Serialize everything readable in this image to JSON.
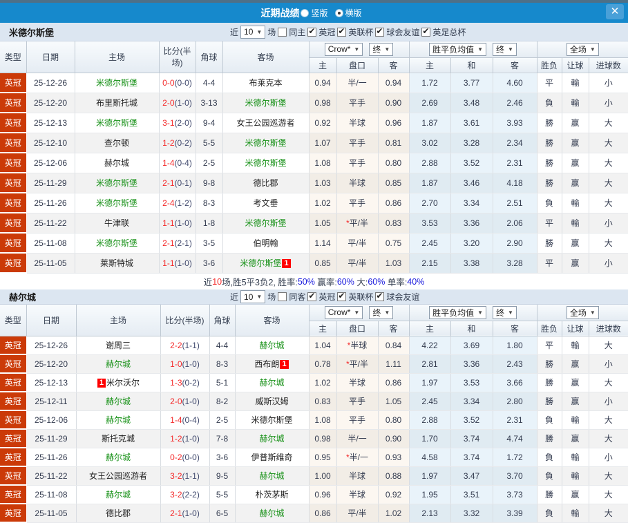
{
  "titlebar": {
    "title": "近期战绩",
    "radio_vertical_label": "竖版",
    "radio_vertical_checked": false,
    "radio_horizontal_label": "横版",
    "radio_horizontal_checked": true,
    "close_label": "✕"
  },
  "colors": {
    "titlebar_blue": "#1689cc",
    "league_badge_red": "#cb3a08",
    "team_green": "#159015",
    "score_red": "#f42a2a",
    "halftime_navy": "#414a6e",
    "win_red": "#d40000",
    "lose_green": "#078007",
    "draw_blue": "#1322cc",
    "band_bg": "#dce6f1"
  },
  "sections": [
    {
      "team": "米德尔斯堡",
      "filters": {
        "near_label": "近",
        "count": "10",
        "games_label": "场",
        "same_label": "同主",
        "same_checked": false,
        "leagues": [
          {
            "label": "英冠",
            "checked": true
          },
          {
            "label": "英联杯",
            "checked": true
          },
          {
            "label": "球会友谊",
            "checked": true
          },
          {
            "label": "英足总杯",
            "checked": true
          }
        ]
      },
      "header": {
        "type": "类型",
        "date": "日期",
        "home": "主场",
        "score": "比分(半场)",
        "corner": "角球",
        "away": "客场",
        "odds_source": "Crow*",
        "odds_period": "终",
        "odds_home": "主",
        "odds_pan": "盘口",
        "odds_away": "客",
        "mean_source": "胜平负均值",
        "mean_period": "终",
        "mean_home": "主",
        "mean_draw": "和",
        "mean_away": "客",
        "full_source": "全场",
        "res_wdl": "胜负",
        "res_handicap": "让球",
        "res_goals": "进球数"
      },
      "rows": [
        {
          "type": "英冠",
          "date": "25-12-26",
          "h": "米德尔斯堡",
          "hc": "g",
          "hb1": "",
          "hb2": "",
          "ft": "0-0",
          "ht": "(0-0)",
          "ck": "4-4",
          "a": "布莱克本",
          "ac": "",
          "ab1": "",
          "ab2": "",
          "o1": "0.94",
          "st": "",
          "pan": "半/一",
          "o2": "0.94",
          "m1": "1.72",
          "m2": "3.77",
          "m3": "4.60",
          "r1": "平",
          "c1": "b",
          "r2": "輸",
          "c2": "g",
          "r3": "小",
          "c3": "g"
        },
        {
          "type": "英冠",
          "date": "25-12-20",
          "h": "布里斯托城",
          "hc": "",
          "hb1": "",
          "hb2": "",
          "ft": "2-0",
          "ht": "(1-0)",
          "ck": "3-13",
          "a": "米德尔斯堡",
          "ac": "g",
          "ab1": "",
          "ab2": "",
          "o1": "0.98",
          "st": "",
          "pan": "平手",
          "o2": "0.90",
          "m1": "2.69",
          "m2": "3.48",
          "m3": "2.46",
          "r1": "負",
          "c1": "g",
          "r2": "輸",
          "c2": "g",
          "r3": "小",
          "c3": "g"
        },
        {
          "type": "英冠",
          "date": "25-12-13",
          "h": "米德尔斯堡",
          "hc": "g",
          "hb1": "",
          "hb2": "",
          "ft": "3-1",
          "ht": "(2-0)",
          "ck": "9-4",
          "a": "女王公园巡游者",
          "ac": "",
          "ab1": "",
          "ab2": "",
          "o1": "0.92",
          "st": "",
          "pan": "半球",
          "o2": "0.96",
          "m1": "1.87",
          "m2": "3.61",
          "m3": "3.93",
          "r1": "勝",
          "c1": "r",
          "r2": "赢",
          "c2": "r",
          "r3": "大",
          "c3": "r"
        },
        {
          "type": "英冠",
          "date": "25-12-10",
          "h": "查尔顿",
          "hc": "",
          "hb1": "",
          "hb2": "",
          "ft": "1-2",
          "ht": "(0-2)",
          "ck": "5-5",
          "a": "米德尔斯堡",
          "ac": "g",
          "ab1": "",
          "ab2": "",
          "o1": "1.07",
          "st": "",
          "pan": "平手",
          "o2": "0.81",
          "m1": "3.02",
          "m2": "3.28",
          "m3": "2.34",
          "r1": "勝",
          "c1": "r",
          "r2": "赢",
          "c2": "r",
          "r3": "大",
          "c3": "r"
        },
        {
          "type": "英冠",
          "date": "25-12-06",
          "h": "赫尔城",
          "hc": "",
          "hb1": "",
          "hb2": "",
          "ft": "1-4",
          "ht": "(0-4)",
          "ck": "2-5",
          "a": "米德尔斯堡",
          "ac": "g",
          "ab1": "",
          "ab2": "",
          "o1": "1.08",
          "st": "",
          "pan": "平手",
          "o2": "0.80",
          "m1": "2.88",
          "m2": "3.52",
          "m3": "2.31",
          "r1": "勝",
          "c1": "r",
          "r2": "赢",
          "c2": "r",
          "r3": "大",
          "c3": "r"
        },
        {
          "type": "英冠",
          "date": "25-11-29",
          "h": "米德尔斯堡",
          "hc": "g",
          "hb1": "",
          "hb2": "",
          "ft": "2-1",
          "ht": "(0-1)",
          "ck": "9-8",
          "a": "德比郡",
          "ac": "",
          "ab1": "",
          "ab2": "",
          "o1": "1.03",
          "st": "",
          "pan": "半球",
          "o2": "0.85",
          "m1": "1.87",
          "m2": "3.46",
          "m3": "4.18",
          "r1": "勝",
          "c1": "r",
          "r2": "赢",
          "c2": "r",
          "r3": "大",
          "c3": "r"
        },
        {
          "type": "英冠",
          "date": "25-11-26",
          "h": "米德尔斯堡",
          "hc": "g",
          "hb1": "",
          "hb2": "",
          "ft": "2-4",
          "ht": "(1-2)",
          "ck": "8-3",
          "a": "考文垂",
          "ac": "",
          "ab1": "",
          "ab2": "",
          "o1": "1.02",
          "st": "",
          "pan": "平手",
          "o2": "0.86",
          "m1": "2.70",
          "m2": "3.34",
          "m3": "2.51",
          "r1": "負",
          "c1": "g",
          "r2": "輸",
          "c2": "g",
          "r3": "大",
          "c3": "r"
        },
        {
          "type": "英冠",
          "date": "25-11-22",
          "h": "牛津联",
          "hc": "",
          "hb1": "",
          "hb2": "",
          "ft": "1-1",
          "ht": "(1-0)",
          "ck": "1-8",
          "a": "米德尔斯堡",
          "ac": "g",
          "ab1": "",
          "ab2": "",
          "o1": "1.05",
          "st": "*",
          "pan": "平/半",
          "o2": "0.83",
          "m1": "3.53",
          "m2": "3.36",
          "m3": "2.06",
          "r1": "平",
          "c1": "b",
          "r2": "輸",
          "c2": "g",
          "r3": "小",
          "c3": "g"
        },
        {
          "type": "英冠",
          "date": "25-11-08",
          "h": "米德尔斯堡",
          "hc": "g",
          "hb1": "",
          "hb2": "",
          "ft": "2-1",
          "ht": "(2-1)",
          "ck": "3-5",
          "a": "伯明翰",
          "ac": "",
          "ab1": "",
          "ab2": "",
          "o1": "1.14",
          "st": "",
          "pan": "平/半",
          "o2": "0.75",
          "m1": "2.45",
          "m2": "3.20",
          "m3": "2.90",
          "r1": "勝",
          "c1": "r",
          "r2": "赢",
          "c2": "r",
          "r3": "大",
          "c3": "r"
        },
        {
          "type": "英冠",
          "date": "25-11-05",
          "h": "莱斯特城",
          "hc": "",
          "hb1": "",
          "hb2": "",
          "ft": "1-1",
          "ht": "(1-0)",
          "ck": "3-6",
          "a": "米德尔斯堡",
          "ac": "g",
          "ab1": "",
          "ab2": "1",
          "o1": "0.85",
          "st": "",
          "pan": "平/半",
          "o2": "1.03",
          "m1": "2.15",
          "m2": "3.38",
          "m3": "3.28",
          "r1": "平",
          "c1": "b",
          "r2": "赢",
          "c2": "r",
          "r3": "小",
          "c3": "g"
        }
      ],
      "summary": {
        "parts": [
          {
            "t": "近",
            "c": "d"
          },
          {
            "t": "10",
            "c": "r"
          },
          {
            "t": "场,胜5平3负2, 胜率:",
            "c": "d"
          },
          {
            "t": "50%",
            "c": "b"
          },
          {
            "t": " 赢率:",
            "c": "d"
          },
          {
            "t": "60%",
            "c": "b"
          },
          {
            "t": " 大:",
            "c": "d"
          },
          {
            "t": "60%",
            "c": "b"
          },
          {
            "t": " 单率:",
            "c": "d"
          },
          {
            "t": "40%",
            "c": "b"
          }
        ]
      }
    },
    {
      "team": "赫尔城",
      "filters": {
        "near_label": "近",
        "count": "10",
        "games_label": "场",
        "same_label": "同客",
        "same_checked": false,
        "leagues": [
          {
            "label": "英冠",
            "checked": true
          },
          {
            "label": "英联杯",
            "checked": true
          },
          {
            "label": "球会友谊",
            "checked": true
          }
        ]
      },
      "header": {
        "type": "类型",
        "date": "日期",
        "home": "主场",
        "score": "比分(半场)",
        "corner": "角球",
        "away": "客场",
        "odds_source": "Crow*",
        "odds_period": "终",
        "odds_home": "主",
        "odds_pan": "盘口",
        "odds_away": "客",
        "mean_source": "胜平负均值",
        "mean_period": "终",
        "mean_home": "主",
        "mean_draw": "和",
        "mean_away": "客",
        "full_source": "全场",
        "res_wdl": "胜负",
        "res_handicap": "让球",
        "res_goals": "进球数"
      },
      "rows": [
        {
          "type": "英冠",
          "date": "25-12-26",
          "h": "谢周三",
          "hc": "",
          "hb1": "",
          "hb2": "",
          "ft": "2-2",
          "ht": "(1-1)",
          "ck": "4-4",
          "a": "赫尔城",
          "ac": "g",
          "ab1": "",
          "ab2": "",
          "o1": "1.04",
          "st": "*",
          "pan": "半球",
          "o2": "0.84",
          "m1": "4.22",
          "m2": "3.69",
          "m3": "1.80",
          "r1": "平",
          "c1": "b",
          "r2": "輸",
          "c2": "g",
          "r3": "大",
          "c3": "r"
        },
        {
          "type": "英冠",
          "date": "25-12-20",
          "h": "赫尔城",
          "hc": "g",
          "hb1": "",
          "hb2": "",
          "ft": "1-0",
          "ht": "(1-0)",
          "ck": "8-3",
          "a": "西布朗",
          "ac": "",
          "ab1": "",
          "ab2": "1",
          "o1": "0.78",
          "st": "*",
          "pan": "平/半",
          "o2": "1.11",
          "m1": "2.81",
          "m2": "3.36",
          "m3": "2.43",
          "r1": "勝",
          "c1": "r",
          "r2": "赢",
          "c2": "r",
          "r3": "小",
          "c3": "g"
        },
        {
          "type": "英冠",
          "date": "25-12-13",
          "h": "米尔沃尔",
          "hc": "",
          "hb1": "1",
          "hb2": "",
          "ft": "1-3",
          "ht": "(0-2)",
          "ck": "5-1",
          "a": "赫尔城",
          "ac": "g",
          "ab1": "",
          "ab2": "",
          "o1": "1.02",
          "st": "",
          "pan": "半球",
          "o2": "0.86",
          "m1": "1.97",
          "m2": "3.53",
          "m3": "3.66",
          "r1": "勝",
          "c1": "r",
          "r2": "赢",
          "c2": "r",
          "r3": "大",
          "c3": "r"
        },
        {
          "type": "英冠",
          "date": "25-12-11",
          "h": "赫尔城",
          "hc": "g",
          "hb1": "",
          "hb2": "",
          "ft": "2-0",
          "ht": "(1-0)",
          "ck": "8-2",
          "a": "威斯汉姆",
          "ac": "",
          "ab1": "",
          "ab2": "",
          "o1": "0.83",
          "st": "",
          "pan": "平手",
          "o2": "1.05",
          "m1": "2.45",
          "m2": "3.34",
          "m3": "2.80",
          "r1": "勝",
          "c1": "r",
          "r2": "赢",
          "c2": "r",
          "r3": "小",
          "c3": "g"
        },
        {
          "type": "英冠",
          "date": "25-12-06",
          "h": "赫尔城",
          "hc": "g",
          "hb1": "",
          "hb2": "",
          "ft": "1-4",
          "ht": "(0-4)",
          "ck": "2-5",
          "a": "米德尔斯堡",
          "ac": "",
          "ab1": "",
          "ab2": "",
          "o1": "1.08",
          "st": "",
          "pan": "平手",
          "o2": "0.80",
          "m1": "2.88",
          "m2": "3.52",
          "m3": "2.31",
          "r1": "負",
          "c1": "g",
          "r2": "輸",
          "c2": "g",
          "r3": "大",
          "c3": "r"
        },
        {
          "type": "英冠",
          "date": "25-11-29",
          "h": "斯托克城",
          "hc": "",
          "hb1": "",
          "hb2": "",
          "ft": "1-2",
          "ht": "(1-0)",
          "ck": "7-8",
          "a": "赫尔城",
          "ac": "g",
          "ab1": "",
          "ab2": "",
          "o1": "0.98",
          "st": "",
          "pan": "半/一",
          "o2": "0.90",
          "m1": "1.70",
          "m2": "3.74",
          "m3": "4.74",
          "r1": "勝",
          "c1": "r",
          "r2": "赢",
          "c2": "r",
          "r3": "大",
          "c3": "r"
        },
        {
          "type": "英冠",
          "date": "25-11-26",
          "h": "赫尔城",
          "hc": "g",
          "hb1": "",
          "hb2": "",
          "ft": "0-2",
          "ht": "(0-0)",
          "ck": "3-6",
          "a": "伊普斯维奇",
          "ac": "",
          "ab1": "",
          "ab2": "",
          "o1": "0.95",
          "st": "*",
          "pan": "半/一",
          "o2": "0.93",
          "m1": "4.58",
          "m2": "3.74",
          "m3": "1.72",
          "r1": "負",
          "c1": "g",
          "r2": "輸",
          "c2": "g",
          "r3": "小",
          "c3": "g"
        },
        {
          "type": "英冠",
          "date": "25-11-22",
          "h": "女王公园巡游者",
          "hc": "",
          "hb1": "",
          "hb2": "",
          "ft": "3-2",
          "ht": "(1-1)",
          "ck": "9-5",
          "a": "赫尔城",
          "ac": "g",
          "ab1": "",
          "ab2": "",
          "o1": "1.00",
          "st": "",
          "pan": "半球",
          "o2": "0.88",
          "m1": "1.97",
          "m2": "3.47",
          "m3": "3.70",
          "r1": "負",
          "c1": "g",
          "r2": "輸",
          "c2": "g",
          "r3": "大",
          "c3": "r"
        },
        {
          "type": "英冠",
          "date": "25-11-08",
          "h": "赫尔城",
          "hc": "g",
          "hb1": "",
          "hb2": "",
          "ft": "3-2",
          "ht": "(2-2)",
          "ck": "5-5",
          "a": "朴茨茅斯",
          "ac": "",
          "ab1": "",
          "ab2": "",
          "o1": "0.96",
          "st": "",
          "pan": "半球",
          "o2": "0.92",
          "m1": "1.95",
          "m2": "3.51",
          "m3": "3.73",
          "r1": "勝",
          "c1": "r",
          "r2": "赢",
          "c2": "r",
          "r3": "大",
          "c3": "r"
        },
        {
          "type": "英冠",
          "date": "25-11-05",
          "h": "德比郡",
          "hc": "",
          "hb1": "",
          "hb2": "",
          "ft": "2-1",
          "ht": "(1-0)",
          "ck": "6-5",
          "a": "赫尔城",
          "ac": "g",
          "ab1": "",
          "ab2": "",
          "o1": "0.86",
          "st": "",
          "pan": "平/半",
          "o2": "1.02",
          "m1": "2.13",
          "m2": "3.32",
          "m3": "3.39",
          "r1": "負",
          "c1": "g",
          "r2": "輸",
          "c2": "g",
          "r3": "大",
          "c3": "r"
        }
      ]
    }
  ]
}
